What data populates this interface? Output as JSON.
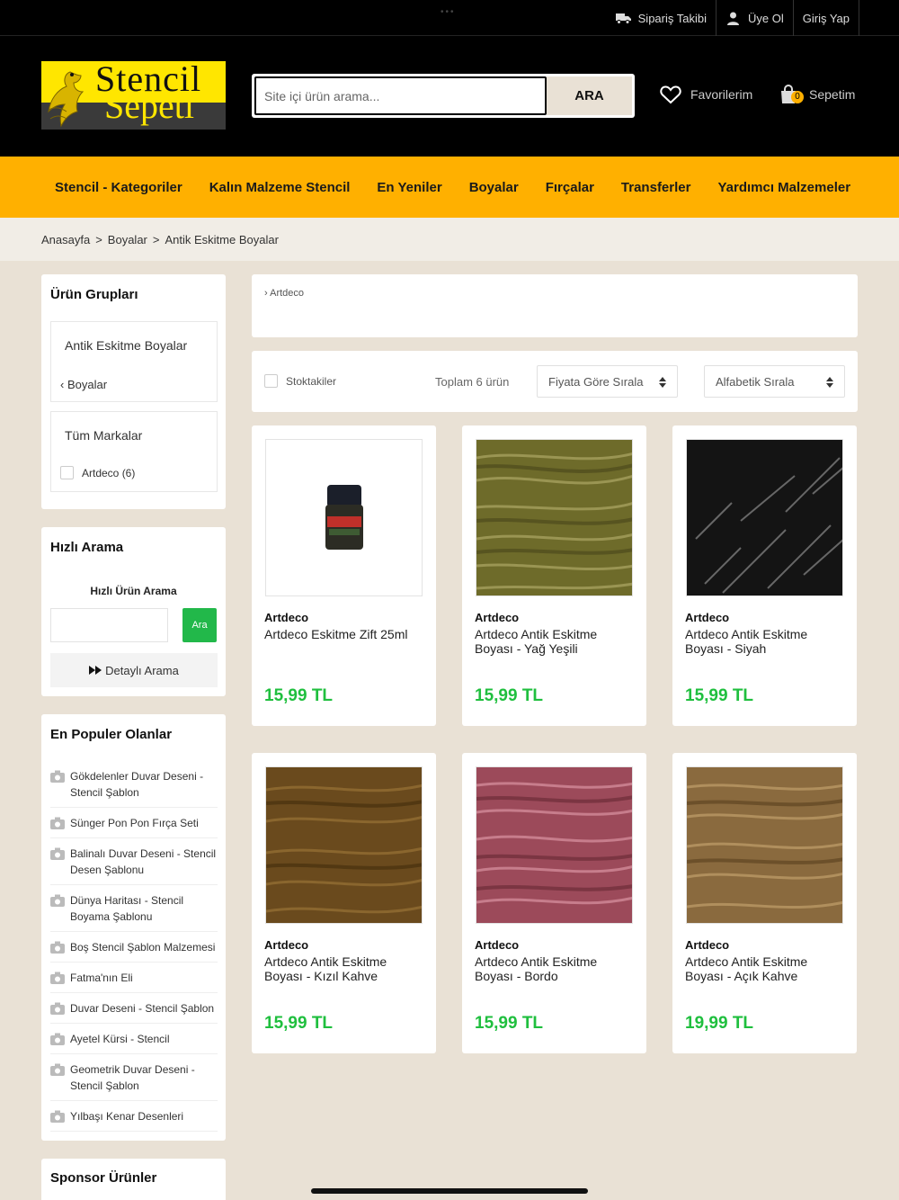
{
  "topbar": {
    "links": [
      {
        "label": "Sipariş Takibi",
        "icon": "truck-icon"
      },
      {
        "label": "Üye Ol",
        "icon": "user-icon"
      },
      {
        "label": "Giriş Yap",
        "icon": ""
      }
    ]
  },
  "header": {
    "logo_line1": "Stencil",
    "logo_line2": "Sepeti",
    "search_placeholder": "Site içi ürün arama...",
    "search_button": "ARA",
    "favorites_label": "Favorilerim",
    "basket_label": "Sepetim",
    "basket_count": "0"
  },
  "nav": {
    "items": [
      "Stencil - Kategoriler",
      "Kalın Malzeme Stencil",
      "En Yeniler",
      "Boyalar",
      "Fırçalar",
      "Transferler",
      "Yardımcı Malzemeler"
    ]
  },
  "breadcrumb": {
    "items": [
      "Anasayfa",
      "Boyalar",
      "Antik Eskitme Boyalar"
    ],
    "separator": ">"
  },
  "sidebar": {
    "groups_title": "Ürün Grupları",
    "current_group": "Antik Eskitme Boyalar",
    "parent_group": "Boyalar",
    "brands_title": "Tüm Markalar",
    "brand_filter": "Artdeco (6)",
    "quick_search_title": "Hızlı Arama",
    "quick_search_label": "Hızlı Ürün Arama",
    "quick_search_button": "Ara",
    "detailed_search": "Detaylı Arama",
    "popular_title": "En Populer Olanlar",
    "popular_items": [
      "Gökdelenler Duvar Deseni - Stencil Şablon",
      "Sünger Pon Pon Fırça Seti",
      "Balinalı Duvar Deseni - Stencil Desen Şablonu",
      "Dünya Haritası - Stencil Boyama Şablonu",
      "Boş Stencil Şablon Malzemesi",
      "Fatma'nın Eli",
      "Duvar Deseni - Stencil Şablon",
      "Ayetel Kürsi - Stencil",
      "Geometrik Duvar Deseni - Stencil Şablon",
      "Yılbaşı Kenar Desenleri"
    ],
    "sponsor_title": "Sponsor Ürünler"
  },
  "content": {
    "brand_link": "Artdeco",
    "in_stock_label": "Stoktakiler",
    "total_label": "Toplam 6 ürün",
    "sort_price": "Fiyata Göre Sırala",
    "sort_alpha": "Alfabetik Sırala",
    "products": [
      {
        "brand": "Artdeco",
        "name": "Artdeco Eskitme Zift 25ml",
        "price": "15,99 TL",
        "swatch": "bottle",
        "color": "#ffffff"
      },
      {
        "brand": "Artdeco",
        "name": "Artdeco Antik Eskitme Boyası - Yağ Yeşili",
        "price": "15,99 TL",
        "swatch": "paint",
        "color": "#6e6b2a"
      },
      {
        "brand": "Artdeco",
        "name": "Artdeco Antik Eskitme Boyası - Siyah",
        "price": "15,99 TL",
        "swatch": "paint",
        "color": "#141414"
      },
      {
        "brand": "Artdeco",
        "name": "Artdeco Antik Eskitme Boyası - Kızıl Kahve",
        "price": "15,99 TL",
        "swatch": "paint",
        "color": "#6a4a1d"
      },
      {
        "brand": "Artdeco",
        "name": "Artdeco Antik Eskitme Boyası - Bordo",
        "price": "15,99 TL",
        "swatch": "paint",
        "color": "#9c4a5a"
      },
      {
        "brand": "Artdeco",
        "name": "Artdeco Antik Eskitme Boyası - Açık Kahve",
        "price": "19,99 TL",
        "swatch": "paint",
        "color": "#8a6a3e"
      }
    ]
  },
  "colors": {
    "accent": "#ffb000",
    "price": "#1fbf3e",
    "header_bg": "#000000",
    "page_bg": "#e9e1d5",
    "button_green": "#22b84a"
  }
}
